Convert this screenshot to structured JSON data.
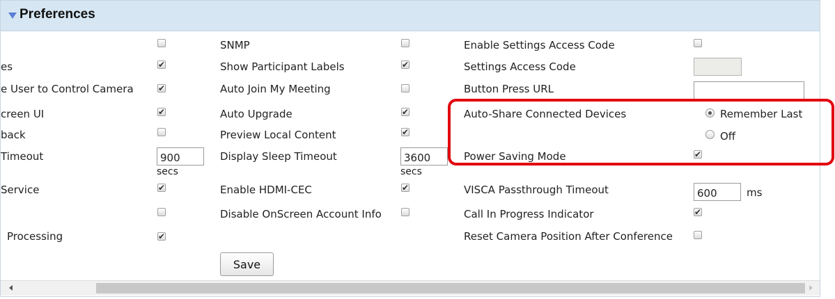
{
  "header": {
    "title": "Preferences"
  },
  "col1": {
    "labels": [
      "es",
      "e User to Control Camera",
      "creen UI",
      "back",
      "Timeout",
      "Service",
      "Processing"
    ],
    "checkboxes": [
      false,
      true,
      true,
      true,
      false,
      true,
      false,
      true
    ],
    "timeout_value": "900",
    "timeout_unit": "secs"
  },
  "col2": {
    "labels": [
      "SNMP",
      "Show Participant Labels",
      "Auto Join My Meeting",
      "Auto Upgrade",
      "Preview Local Content",
      "Display Sleep Timeout",
      "Enable HDMI-CEC",
      "Disable OnScreen Account Info"
    ],
    "checkboxes": [
      false,
      true,
      false,
      true,
      true,
      true,
      false
    ],
    "sleep_value": "3600",
    "sleep_unit": "secs"
  },
  "col3": {
    "labels": [
      "Enable Settings Access Code",
      "Settings Access Code",
      "Button Press URL",
      "Auto-Share Connected Devices",
      "Power Saving Mode",
      "VISCA Passthrough Timeout",
      "Call In Progress Indicator",
      "Reset Camera Position After Conference"
    ],
    "enable_access_code": false,
    "access_code_value": "",
    "button_press_url_value": "",
    "auto_share_options": [
      "Remember Last",
      "Off"
    ],
    "auto_share_selected": "Remember Last",
    "power_saving": true,
    "visca_value": "600",
    "visca_unit": "ms",
    "call_in_progress": true,
    "reset_camera": false
  },
  "save_label": "Save",
  "colors": {
    "header_bg": "#d6e6f3",
    "highlight": "#e2000f"
  }
}
